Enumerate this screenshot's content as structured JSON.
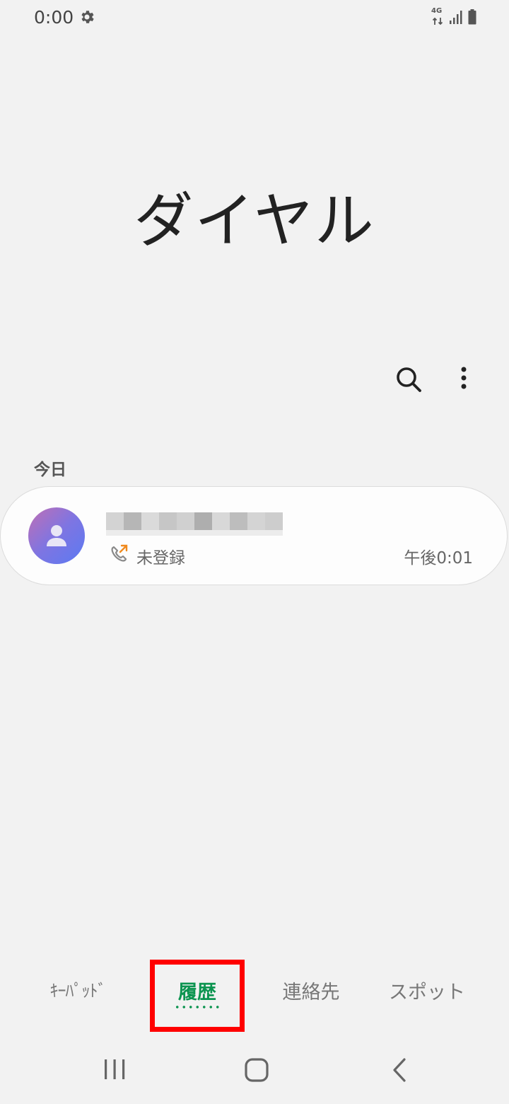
{
  "status_bar": {
    "time": "0:00",
    "network": "4G",
    "icons": [
      "gear-icon",
      "network-4g-icon",
      "signal-icon",
      "battery-icon"
    ]
  },
  "app": {
    "title": "ダイヤル"
  },
  "toolbar": {
    "icons": [
      "search-icon",
      "more-options-icon"
    ]
  },
  "call_log": {
    "section_header": "今日",
    "entries": [
      {
        "name": "",
        "type_icon": "outgoing-call-icon",
        "label": "未登録",
        "time": "午後0:01",
        "avatar_icon": "person-icon"
      }
    ]
  },
  "bottom_tabs": {
    "items": [
      {
        "label": "ｷｰﾊﾟｯﾄﾞ",
        "selected": false
      },
      {
        "label": "履歴",
        "selected": true
      },
      {
        "label": "連絡先",
        "selected": false
      },
      {
        "label": "スポット",
        "selected": false
      }
    ]
  },
  "nav_bar": {
    "icons": [
      "recent-apps-icon",
      "home-icon",
      "back-icon"
    ]
  },
  "colors": {
    "background": "#f2f2f2",
    "accent": "#0c9450",
    "highlight": "#ff0000",
    "card": "#fdfdfd",
    "outgoing_arrow": "#f08a1e"
  }
}
